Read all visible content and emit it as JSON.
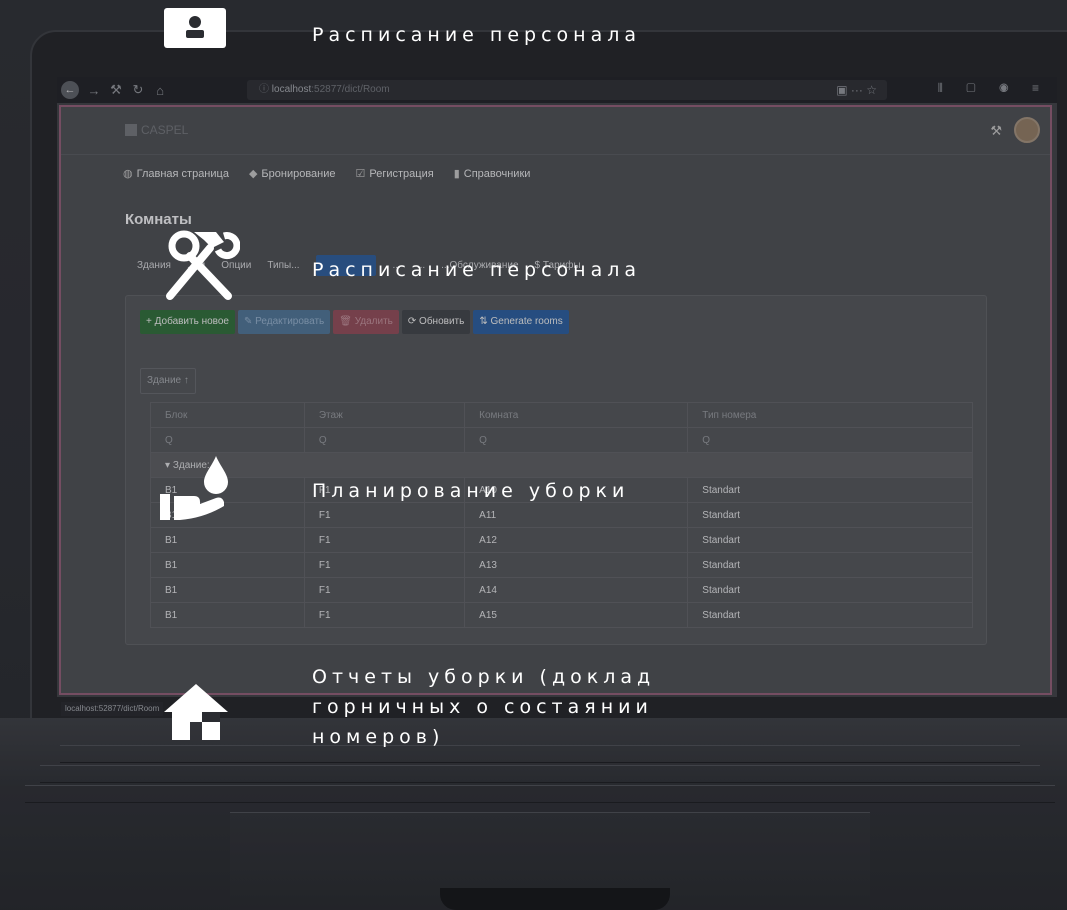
{
  "overlay": {
    "items": [
      {
        "icon": "person-icon",
        "text": "Расписание персонала"
      },
      {
        "icon": "hammer-wrench-icon",
        "text": "Расписание персонала"
      },
      {
        "icon": "hand-droplet-icon",
        "text": "Планирование уборки"
      },
      {
        "icon": "house-icon",
        "text": "Отчеты уборки (доклад горничных о состаянии номеров)"
      }
    ]
  },
  "browser": {
    "url_host": "localhost",
    "url_path": ":52877/dict/Room",
    "status_url": "localhost:52877/dict/Room"
  },
  "app": {
    "logo": "CASPEL",
    "nav": [
      "Главная страница",
      "Бронирование",
      "Регистрация",
      "Справочники"
    ],
    "page_title": "Комнаты",
    "tabs": [
      "Здания",
      "...ки",
      "Опции",
      "Типы...",
      "Комнаты",
      "...",
      "...",
      "...Обслуживание",
      "$ Тарифы"
    ],
    "toolbar": {
      "add": "+ Добавить новое",
      "edit": "✎ Редактировать",
      "delete": "🗑 Удалить",
      "refresh": "⟳ Обновить",
      "generate": "⇅ Generate rooms"
    },
    "group_chip": "Здание ↑",
    "table": {
      "columns": [
        "Блок",
        "Этаж",
        "Комната",
        "Тип номера"
      ],
      "filter_symbol": "Q",
      "group_row": "Здание:",
      "rows": [
        [
          "B1",
          "F1",
          "A10",
          "Standart"
        ],
        [
          "B1",
          "F1",
          "A11",
          "Standart"
        ],
        [
          "B1",
          "F1",
          "A12",
          "Standart"
        ],
        [
          "B1",
          "F1",
          "A13",
          "Standart"
        ],
        [
          "B1",
          "F1",
          "A14",
          "Standart"
        ],
        [
          "B1",
          "F1",
          "A15",
          "Standart"
        ]
      ]
    }
  }
}
